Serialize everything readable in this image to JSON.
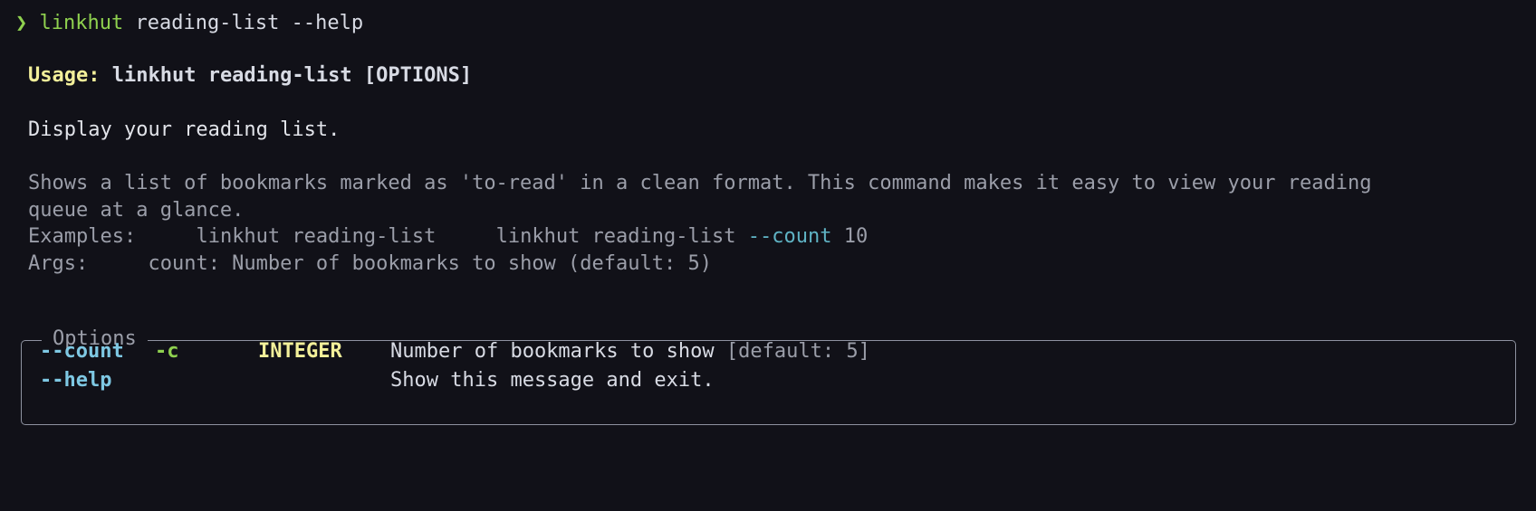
{
  "prompt": {
    "symbol": "❯",
    "command": "linkhut",
    "args": "reading-list --help"
  },
  "usage": {
    "label": "Usage:",
    "text": "linkhut reading-list [OPTIONS]"
  },
  "summary": "Display your reading list.",
  "description": {
    "line1": "Shows a list of bookmarks marked as 'to-read' in a clean format. This command makes it easy to view your reading",
    "line2": "queue at a glance."
  },
  "examples": {
    "label": "Examples:",
    "example1": "linkhut reading-list",
    "example2_cmd": "linkhut reading-list",
    "example2_flag": "--count",
    "example2_value": "10"
  },
  "args": {
    "label": "Args:",
    "text": "count: Number of bookmarks to show (default: 5)"
  },
  "options": {
    "title": "Options",
    "rows": [
      {
        "long": "--count",
        "short": "-c",
        "type": "INTEGER",
        "description": "Number of bookmarks to show",
        "default": "[default: 5]"
      },
      {
        "long": "--help",
        "short": "",
        "type": "",
        "description": "Show this message and exit.",
        "default": ""
      }
    ]
  },
  "colors": {
    "background": "#111118",
    "prompt_green": "#8fd14f",
    "usage_yellow": "#f3f09a",
    "option_cyan": "#7ec8e3",
    "muted_gray": "#9b9ea9"
  }
}
